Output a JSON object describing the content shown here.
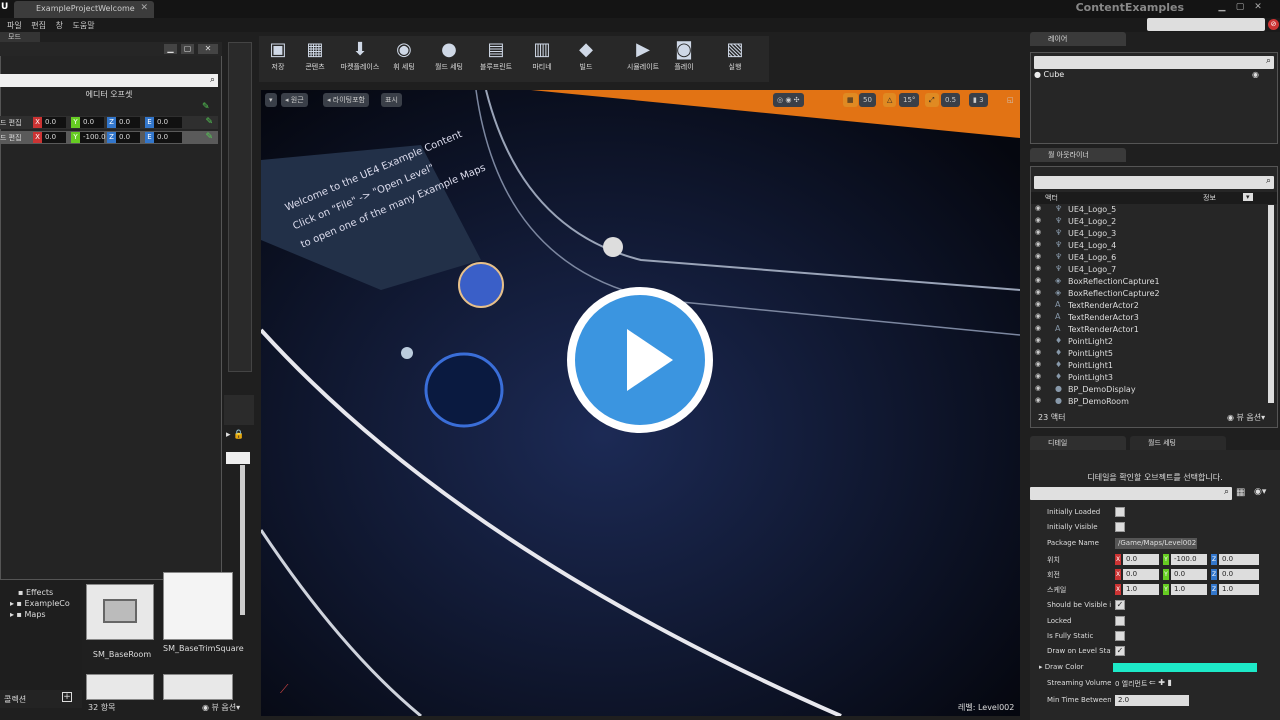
{
  "window": {
    "doc_tab": "ExampleProjectWelcome",
    "project_name": "ContentExamples",
    "menu": [
      "파일",
      "편집",
      "창",
      "도움말"
    ]
  },
  "modes_panel": {
    "tab": "모드",
    "section_label": "에디터 오프셋",
    "rows": [
      {
        "label": "드 편집",
        "x": "0.0",
        "y": "0.0",
        "z": "0.0",
        "w": "0.0"
      },
      {
        "label": "드 편집",
        "x": "0.0",
        "y": "-100.0",
        "z": "0.0",
        "w": "0.0"
      }
    ]
  },
  "content_browser": {
    "tree": [
      "Effects",
      "ExampleCo",
      "Maps"
    ],
    "assets": [
      "SM_BaseRoom",
      "SM_BaseTrimSquare"
    ],
    "collections_label": "콜렉션",
    "count": "32 항목",
    "view_options": "뷰 옵션"
  },
  "toolbar": {
    "buttons": [
      "저장",
      "콘텐츠",
      "마켓플레이스",
      "휘 세팅",
      "월드 세팅",
      "블루프린트",
      "마티네",
      "빌드",
      "시뮬레이트",
      "플레이",
      "실행"
    ]
  },
  "viewport": {
    "perspective": "원근",
    "lighting": "라이팅포함",
    "show": "표시",
    "grid_snap": "50",
    "rot_snap": "15°",
    "scale_snap": "0.5",
    "cam_speed": "3",
    "welcome_lines": [
      "Welcome to the UE4 Example Content",
      "Click on \"File\" -> \"Open Level\"",
      "to open one of the many Example Maps"
    ],
    "level_label": "레벨:  Level002"
  },
  "layers": {
    "tab": "레이어",
    "items": [
      "Cube"
    ]
  },
  "outliner": {
    "tab": "월 아웃라이너",
    "col_actor": "액터",
    "col_info": "정보",
    "items": [
      {
        "name": "UE4_Logo_5",
        "icon": "mesh-icon"
      },
      {
        "name": "UE4_Logo_2",
        "icon": "mesh-icon"
      },
      {
        "name": "UE4_Logo_3",
        "icon": "mesh-icon"
      },
      {
        "name": "UE4_Logo_4",
        "icon": "mesh-icon"
      },
      {
        "name": "UE4_Logo_6",
        "icon": "mesh-icon"
      },
      {
        "name": "UE4_Logo_7",
        "icon": "mesh-icon"
      },
      {
        "name": "BoxReflectionCapture1",
        "icon": "capture-icon"
      },
      {
        "name": "BoxReflectionCapture2",
        "icon": "capture-icon"
      },
      {
        "name": "TextRenderActor2",
        "icon": "text-icon"
      },
      {
        "name": "TextRenderActor3",
        "icon": "text-icon"
      },
      {
        "name": "TextRenderActor1",
        "icon": "text-icon"
      },
      {
        "name": "PointLight2",
        "icon": "light-icon"
      },
      {
        "name": "PointLight5",
        "icon": "light-icon"
      },
      {
        "name": "PointLight1",
        "icon": "light-icon"
      },
      {
        "name": "PointLight3",
        "icon": "light-icon"
      },
      {
        "name": "BP_DemoDisplay",
        "icon": "blueprint-icon"
      },
      {
        "name": "BP_DemoRoom",
        "icon": "blueprint-icon"
      }
    ],
    "count": "23 액터",
    "view_options": "뷰 옵션"
  },
  "details": {
    "tab": "디테일",
    "tab2": "월드 세팅",
    "message": "디테일을 확인할 오브젝트를 선택합니다.",
    "initially_loaded": "Initially Loaded",
    "initially_visible": "Initially Visible",
    "package_name_label": "Package Name",
    "package_name": "/Game/Maps/Level002",
    "location_label": "위치",
    "rotation_label": "회전",
    "scale_label": "스케일",
    "location": [
      "0.0",
      "-100.0",
      "0.0"
    ],
    "rotation": [
      "0.0",
      "0.0",
      "0.0"
    ],
    "scale": [
      "1.0",
      "1.0",
      "1.0"
    ],
    "should_be_visible": "Should be Visible i",
    "locked": "Locked",
    "fully_static": "Is Fully Static",
    "draw_on_level": "Draw on Level Stat",
    "draw_color": "Draw Color",
    "streaming_volume": "Streaming Volume",
    "streaming_value": "0 엘리먼트",
    "min_time": "Min Time Between",
    "min_time_value": "2.0",
    "accent_color": "#1de9c8"
  }
}
